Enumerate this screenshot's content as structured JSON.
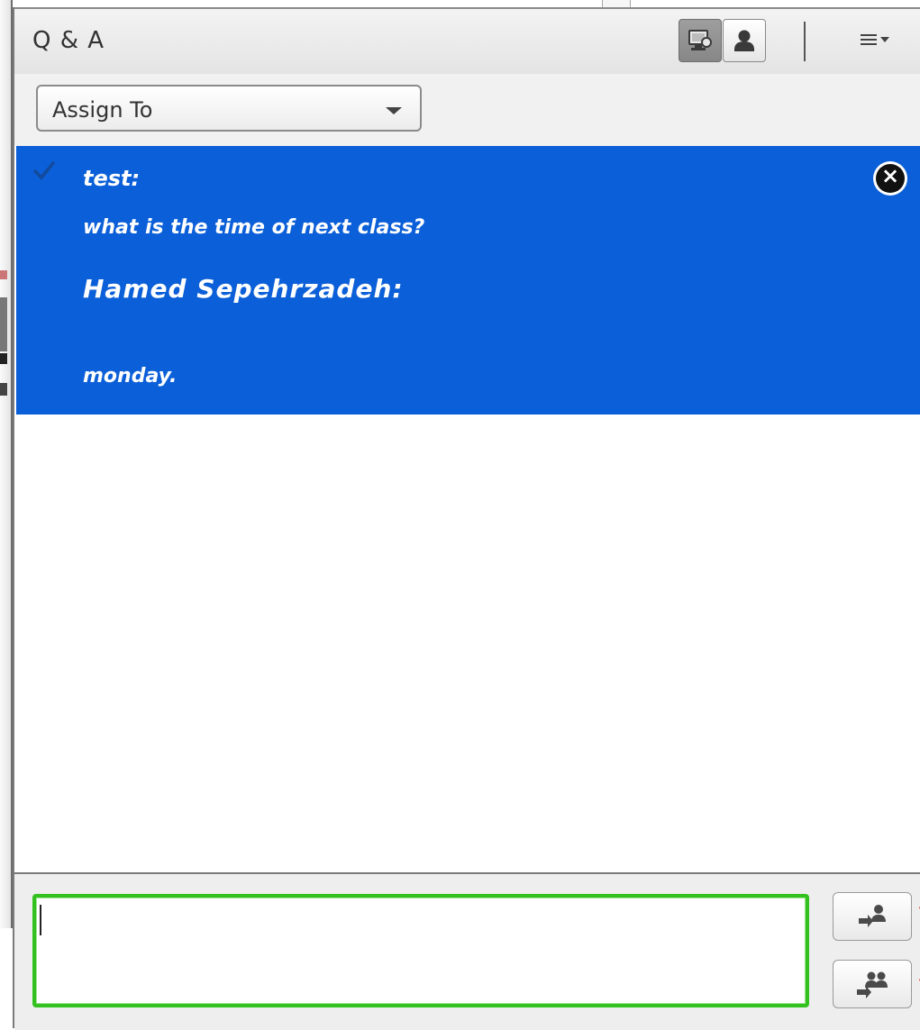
{
  "pod": {
    "title": "Q & A",
    "view_buttons": [
      {
        "name": "presenter-view",
        "icon": "monitor-icon",
        "active": true
      },
      {
        "name": "participant-view",
        "icon": "user-icon",
        "active": false
      }
    ],
    "menu_icon": "menu-icon"
  },
  "toolbar": {
    "assign_label": "Assign To"
  },
  "question": {
    "asker": "test:",
    "text": "what is the time of next class?",
    "responder": "Hamed Sepehrzadeh:",
    "answer": "monday.",
    "status_icon": "checkmark-icon",
    "close_icon": "close-icon"
  },
  "composer": {
    "value": "",
    "send_private_icon": "send-private-icon",
    "send_all_icon": "send-all-icon"
  },
  "colors": {
    "selected_question_bg": "#0b5fd8",
    "composer_focus_border": "#33c11f",
    "titlebar_bg": "#e8e8e8"
  }
}
